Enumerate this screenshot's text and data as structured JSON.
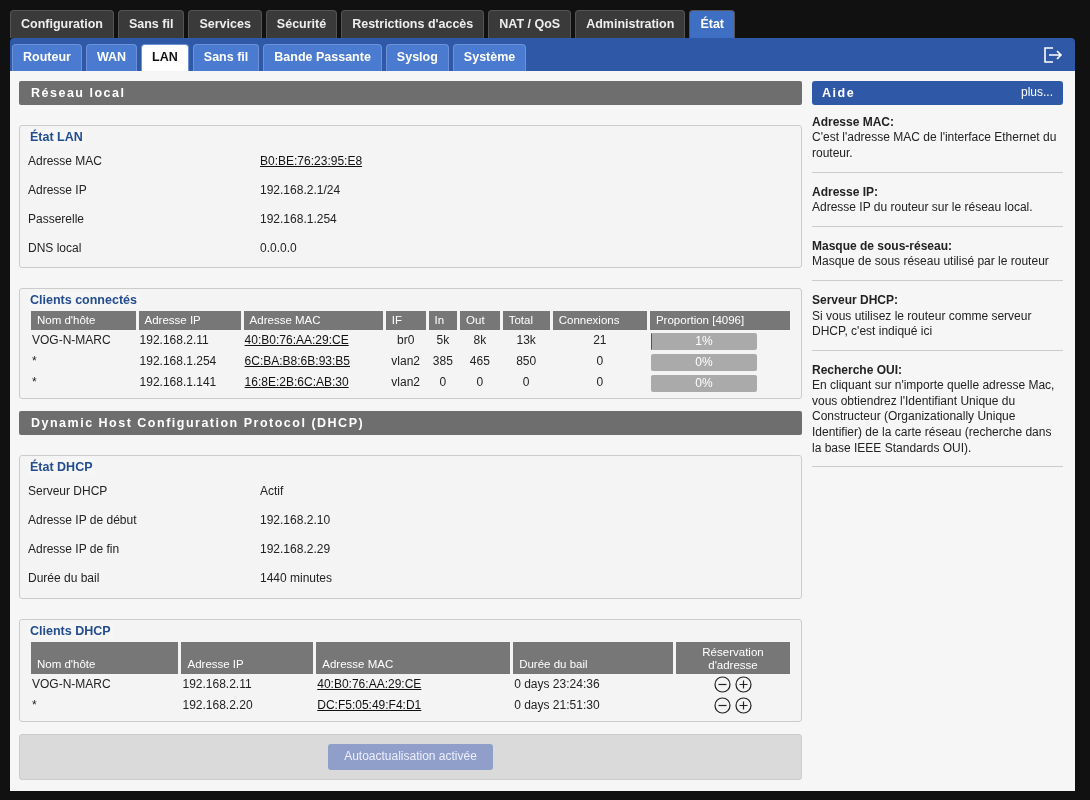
{
  "main_tabs": [
    {
      "label": "Configuration",
      "selected": false
    },
    {
      "label": "Sans fil",
      "selected": false
    },
    {
      "label": "Services",
      "selected": false
    },
    {
      "label": "Sécurité",
      "selected": false
    },
    {
      "label": "Restrictions d'accès",
      "selected": false
    },
    {
      "label": "NAT / QoS",
      "selected": false
    },
    {
      "label": "Administration",
      "selected": false
    },
    {
      "label": "État",
      "selected": true
    }
  ],
  "sub_tabs": [
    {
      "label": "Routeur",
      "selected": false
    },
    {
      "label": "WAN",
      "selected": false
    },
    {
      "label": "LAN",
      "selected": true
    },
    {
      "label": "Sans fil",
      "selected": false
    },
    {
      "label": "Bande Passante",
      "selected": false
    },
    {
      "label": "Syslog",
      "selected": false
    },
    {
      "label": "Système",
      "selected": false
    }
  ],
  "sections": [
    {
      "title": "Réseau local",
      "groups": [
        {
          "kind": "fields",
          "legend": "État LAN",
          "fields": [
            {
              "label": "Adresse MAC",
              "value": "B0:BE:76:23:95:E8",
              "link": true
            },
            {
              "label": "Adresse IP",
              "value": "192.168.2.1/24",
              "link": false
            },
            {
              "label": "Passerelle",
              "value": "192.168.1.254",
              "link": false
            },
            {
              "label": "DNS local",
              "value": "0.0.0.0",
              "link": false
            }
          ]
        },
        {
          "kind": "clients",
          "legend": "Clients connectés",
          "columns": [
            "Nom d'hôte",
            "Adresse IP",
            "Adresse MAC",
            "IF",
            "In",
            "Out",
            "Total",
            "Connexions",
            "Proportion [4096]"
          ],
          "rows": [
            {
              "host": "VOG-N-MARC",
              "ip": "192.168.2.11",
              "mac": "40:B0:76:AA:29:CE",
              "if": "br0",
              "in": "5k",
              "out": "8k",
              "total": "13k",
              "connections": "21",
              "proportion": "1%",
              "level": 0.01
            },
            {
              "host": "*",
              "ip": "192.168.1.254",
              "mac": "6C:BA:B8:6B:93:B5",
              "if": "vlan2",
              "in": "385",
              "out": "465",
              "total": "850",
              "connections": "0",
              "proportion": "0%",
              "level": 0
            },
            {
              "host": "*",
              "ip": "192.168.1.141",
              "mac": "16:8E:2B:6C:AB:30",
              "if": "vlan2",
              "in": "0",
              "out": "0",
              "total": "0",
              "connections": "0",
              "proportion": "0%",
              "level": 0
            }
          ]
        }
      ]
    },
    {
      "title": "Dynamic Host Configuration Protocol (DHCP)",
      "groups": [
        {
          "kind": "fields",
          "legend": "État DHCP",
          "fields": [
            {
              "label": "Serveur DHCP",
              "value": "Actif",
              "link": false
            },
            {
              "label": "Adresse IP de début",
              "value": "192.168.2.10",
              "link": false
            },
            {
              "label": "Adresse IP de fin",
              "value": "192.168.2.29",
              "link": false
            },
            {
              "label": "Durée du bail",
              "value": "1440 minutes",
              "link": false
            }
          ]
        },
        {
          "kind": "leases",
          "legend": "Clients DHCP",
          "columns": [
            "Nom d'hôte",
            "Adresse IP",
            "Adresse MAC",
            "Durée du bail",
            "Réservation d'adresse"
          ],
          "rows": [
            {
              "host": "VOG-N-MARC",
              "ip": "192.168.2.11",
              "mac": "40:B0:76:AA:29:CE",
              "lease": "0 days 23:24:36"
            },
            {
              "host": "*",
              "ip": "192.168.2.20",
              "mac": "DC:F5:05:49:F4:D1",
              "lease": "0 days 21:51:30"
            }
          ]
        }
      ]
    }
  ],
  "refresh_button": {
    "label": "Autoactualisation activée",
    "disabled": true
  },
  "help": {
    "title": "Aide",
    "more": "plus...",
    "items": [
      {
        "term": "Adresse MAC:",
        "text": "C'est l'adresse MAC de l'interface Ethernet du routeur."
      },
      {
        "term": "Adresse IP:",
        "text": "Adresse IP du routeur sur le réseau local."
      },
      {
        "term": "Masque de sous-réseau:",
        "text": "Masque de sous réseau utilisé par le routeur"
      },
      {
        "term": "Serveur DHCP:",
        "text": "Si vous utilisez le routeur comme serveur DHCP, c'est indiqué ici"
      },
      {
        "term": "Recherche OUI:",
        "text": "En cliquant sur n'importe quelle adresse Mac, vous obtiendrez l'Identifiant Unique du Constructeur (Organizationally Unique Identifier) de la carte réseau (recherche dans la base IEEE Standards OUI)."
      }
    ]
  }
}
